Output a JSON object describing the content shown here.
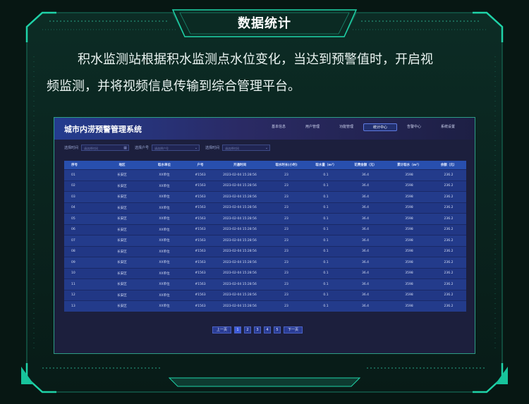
{
  "section_title": "数据统计",
  "description": {
    "line1": "积水监测站根据积水监测点水位变化，当达到预警值时，开启视",
    "line2": "频监测，并将视频信息传输到综合管理平台。"
  },
  "app": {
    "title": "城市内涝预警管理系统",
    "nav": [
      {
        "label": "基本信息",
        "active": false
      },
      {
        "label": "用户管理",
        "active": false
      },
      {
        "label": "功能管理",
        "active": false
      },
      {
        "label": "统计中心",
        "active": true
      },
      {
        "label": "告警中心",
        "active": false
      },
      {
        "label": "系统设置",
        "active": false
      }
    ],
    "filters": [
      {
        "label": "选择时间",
        "placeholder": "请选择时间",
        "icon": "calendar-icon"
      },
      {
        "label": "选择户号",
        "placeholder": "请选择户号",
        "icon": "chevron-down-icon"
      },
      {
        "label": "选择时间",
        "placeholder": "请选择时间",
        "icon": "chevron-down-icon"
      }
    ],
    "table": {
      "columns": [
        "序号",
        "地区",
        "取水单位",
        "户号",
        "开通时间",
        "取水时长(小时)",
        "取水量（m³）",
        "花费金额（元）",
        "累计取水（m³）",
        "余额（元）"
      ],
      "rows": [
        [
          "01",
          "长安区",
          "XX单位",
          "#1563",
          "2023-02-04 15:28:56",
          "23",
          "0.1",
          "36.4",
          "3598",
          "236.2"
        ],
        [
          "02",
          "长安区",
          "XX单位",
          "#1563",
          "2023-02-04 15:28:56",
          "23",
          "0.1",
          "36.4",
          "3598",
          "236.2"
        ],
        [
          "03",
          "长安区",
          "XX单位",
          "#1563",
          "2023-02-04 15:28:56",
          "23",
          "0.1",
          "36.4",
          "3598",
          "236.2"
        ],
        [
          "04",
          "长安区",
          "XX单位",
          "#1563",
          "2023-02-04 15:28:56",
          "23",
          "0.1",
          "36.4",
          "3598",
          "236.2"
        ],
        [
          "05",
          "长安区",
          "XX单位",
          "#1563",
          "2023-02-04 15:28:56",
          "23",
          "0.1",
          "36.4",
          "3598",
          "236.2"
        ],
        [
          "06",
          "长安区",
          "XX单位",
          "#1563",
          "2023-02-04 15:28:56",
          "23",
          "0.1",
          "36.4",
          "3598",
          "236.2"
        ],
        [
          "07",
          "长安区",
          "XX单位",
          "#1563",
          "2023-02-04 15:28:56",
          "23",
          "0.1",
          "36.4",
          "3598",
          "236.2"
        ],
        [
          "08",
          "长安区",
          "XX单位",
          "#1563",
          "2023-02-04 15:28:56",
          "23",
          "0.1",
          "36.4",
          "3598",
          "236.2"
        ],
        [
          "09",
          "长安区",
          "XX单位",
          "#1563",
          "2023-02-04 15:28:56",
          "23",
          "0.1",
          "36.4",
          "3598",
          "236.2"
        ],
        [
          "10",
          "长安区",
          "XX单位",
          "#1563",
          "2023-02-04 15:28:56",
          "23",
          "0.1",
          "36.4",
          "3598",
          "236.2"
        ],
        [
          "11",
          "长安区",
          "XX单位",
          "#1563",
          "2023-02-04 15:28:56",
          "23",
          "0.1",
          "36.4",
          "3598",
          "236.2"
        ],
        [
          "12",
          "长安区",
          "XX单位",
          "#1563",
          "2023-02-04 15:28:56",
          "23",
          "0.1",
          "36.4",
          "3598",
          "236.2"
        ],
        [
          "13",
          "长安区",
          "XX单位",
          "#1563",
          "2023-02-04 15:28:56",
          "23",
          "0.1",
          "36.4",
          "3598",
          "236.2"
        ]
      ]
    },
    "pager": {
      "prev": "上一页",
      "pages": [
        "1",
        "2",
        "3",
        "4",
        "5"
      ],
      "current": "1",
      "next": "下一页"
    }
  },
  "colors": {
    "accent": "#1fd3a8",
    "frame": "#0f4a3c",
    "panel": "#1c1f3d",
    "header_row": "#284fae"
  }
}
